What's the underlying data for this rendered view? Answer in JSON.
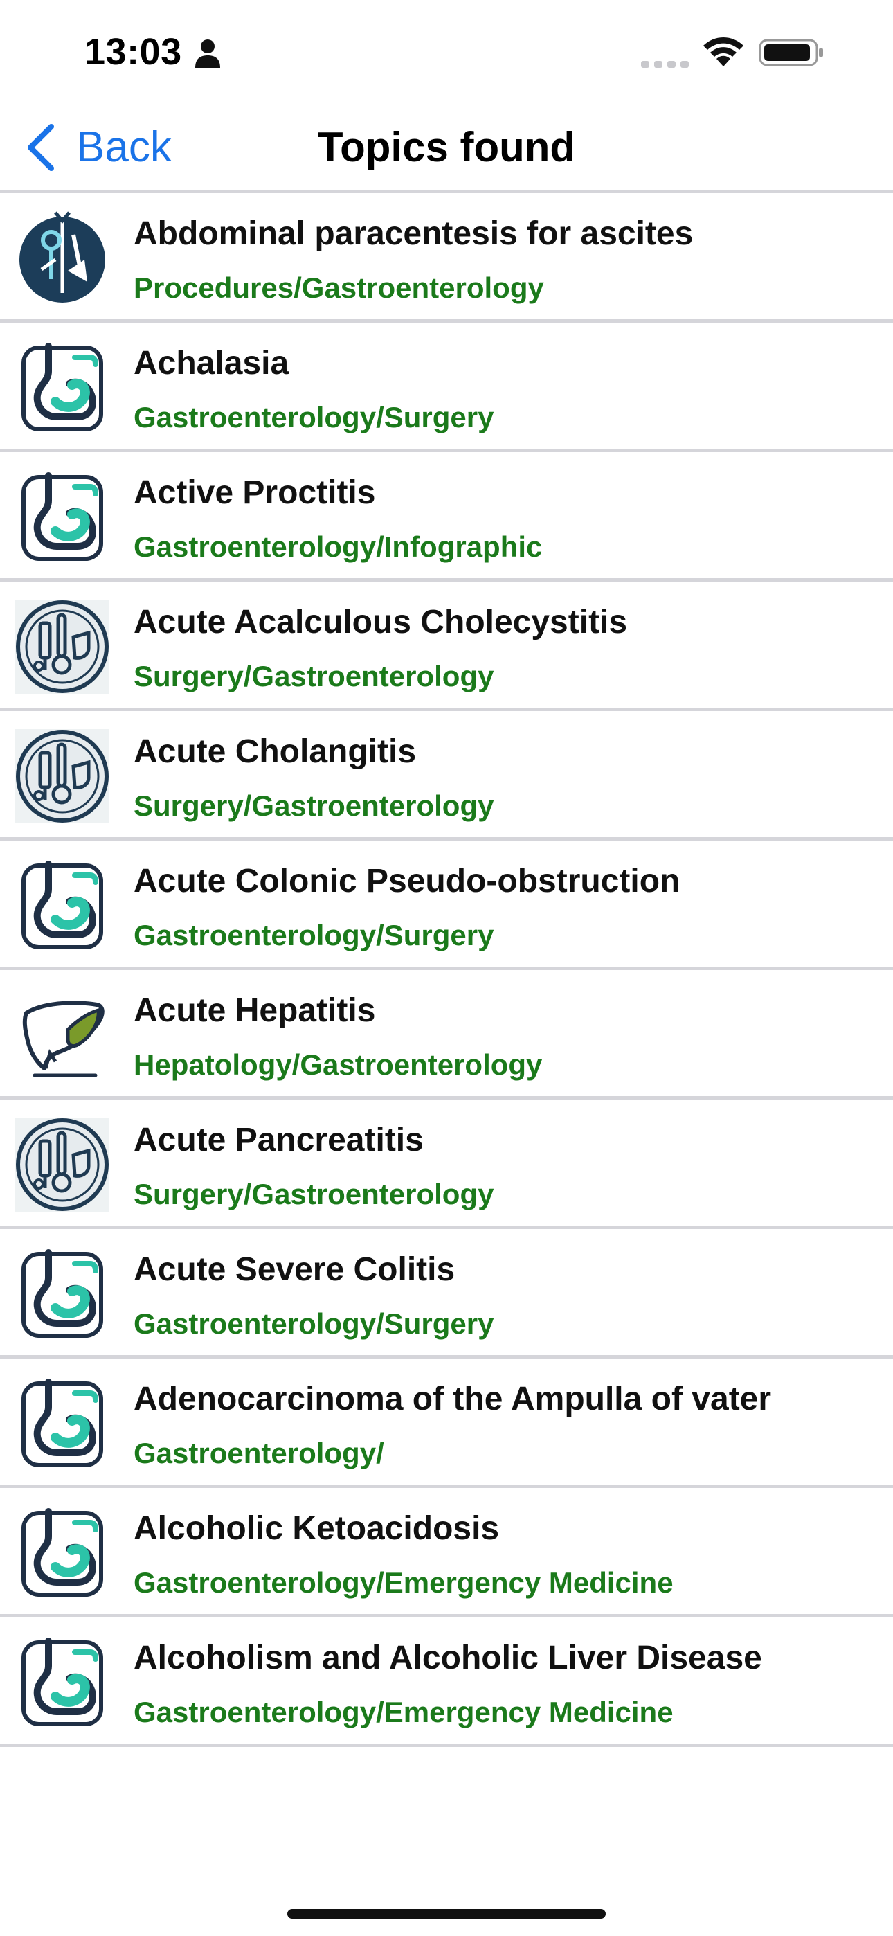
{
  "status_bar": {
    "time": "13:03"
  },
  "nav": {
    "back_label": "Back",
    "title": "Topics found"
  },
  "colors": {
    "accent_blue": "#1a73e8",
    "category_green": "#1b7a1b",
    "separator": "#d5d5da"
  },
  "topics": [
    {
      "title": "Abdominal paracentesis for ascites",
      "category": "Procedures/Gastroenterology",
      "icon": "procedures-icon"
    },
    {
      "title": "Achalasia",
      "category": "Gastroenterology/Surgery",
      "icon": "stomach-icon"
    },
    {
      "title": "Active Proctitis",
      "category": "Gastroenterology/Infographic",
      "icon": "stomach-icon"
    },
    {
      "title": "Acute Acalculous Cholecystitis",
      "category": "Surgery/Gastroenterology",
      "icon": "surgery-icon"
    },
    {
      "title": "Acute Cholangitis",
      "category": "Surgery/Gastroenterology",
      "icon": "surgery-icon"
    },
    {
      "title": "Acute Colonic Pseudo-obstruction",
      "category": "Gastroenterology/Surgery",
      "icon": "stomach-icon"
    },
    {
      "title": "Acute Hepatitis",
      "category": "Hepatology/Gastroenterology",
      "icon": "liver-icon"
    },
    {
      "title": "Acute Pancreatitis",
      "category": "Surgery/Gastroenterology",
      "icon": "surgery-icon"
    },
    {
      "title": "Acute Severe Colitis",
      "category": "Gastroenterology/Surgery",
      "icon": "stomach-icon"
    },
    {
      "title": "Adenocarcinoma of the Ampulla of vater",
      "category": "Gastroenterology/",
      "icon": "stomach-icon"
    },
    {
      "title": "Alcoholic Ketoacidosis",
      "category": "Gastroenterology/Emergency Medicine",
      "icon": "stomach-icon"
    },
    {
      "title": "Alcoholism and Alcoholic Liver Disease",
      "category": "Gastroenterology/Emergency Medicine",
      "icon": "stomach-icon"
    }
  ]
}
